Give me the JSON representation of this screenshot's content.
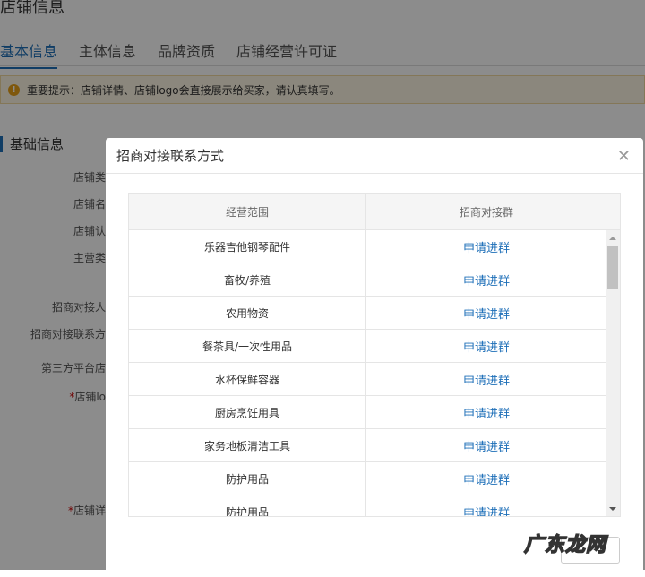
{
  "page": {
    "title": "店铺信息",
    "tabs": [
      "基本信息",
      "主体信息",
      "品牌资质",
      "店铺经营许可证"
    ],
    "notice": "重要提示：店铺详情、店铺logo会直接展示给买家，请认真填写。",
    "section": "基础信息",
    "fields": [
      "店铺类",
      "店铺名",
      "店铺认",
      "主营类",
      "招商对接人",
      "招商对接联系方",
      "第三方平台店",
      "店铺lo",
      "店铺详"
    ]
  },
  "modal": {
    "title": "招商对接联系方式",
    "columns": [
      "经营范围",
      "招商对接群"
    ],
    "rows": [
      {
        "scope": "乐器吉他钢琴配件",
        "action": "申请进群"
      },
      {
        "scope": "畜牧/养殖",
        "action": "申请进群"
      },
      {
        "scope": "农用物资",
        "action": "申请进群"
      },
      {
        "scope": "餐茶具/一次性用品",
        "action": "申请进群"
      },
      {
        "scope": "水杯保鲜容器",
        "action": "申请进群"
      },
      {
        "scope": "厨房烹饪用具",
        "action": "申请进群"
      },
      {
        "scope": "家务地板清洁工具",
        "action": "申请进群"
      },
      {
        "scope": "防护用品",
        "action": "申请进群"
      },
      {
        "scope": "防护用品",
        "action": "申请进群"
      }
    ]
  },
  "watermark": "广东龙网"
}
